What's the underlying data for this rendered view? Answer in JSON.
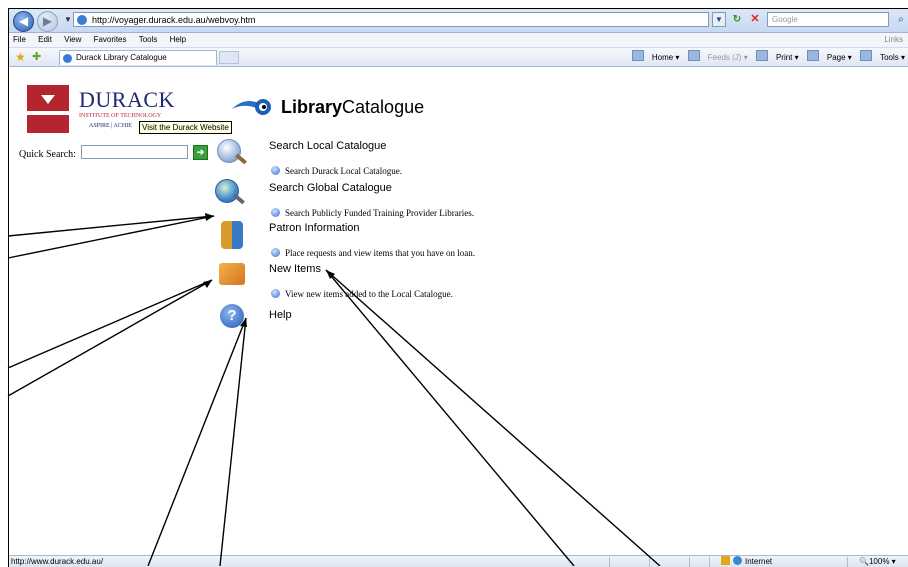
{
  "browser": {
    "url": "http://voyager.durack.edu.au/webvoy.htm",
    "search_placeholder": "Google",
    "menu": [
      "File",
      "Edit",
      "View",
      "Favorites",
      "Tools",
      "Help"
    ],
    "links_label": "Links",
    "tab_title": "Durack Library Catalogue",
    "commands": {
      "home": "Home",
      "feeds": "Feeds (J)",
      "print": "Print",
      "page": "Page",
      "tools": "Tools"
    }
  },
  "page": {
    "institution": {
      "name": "DURACK",
      "subtitle": "INSTITUTE OF TECHNOLOGY",
      "tagline": "ASPIRE | ACHIE"
    },
    "tooltip": "Visit the Durack Website",
    "catalogue_logo": {
      "bold": "Library",
      "normal": "Catalogue"
    },
    "quick_search_label": "Quick Search:",
    "sections": [
      {
        "title": "Search Local Catalogue",
        "link": "Search Durack Local Catalogue."
      },
      {
        "title": "Search Global Catalogue",
        "link": "Search Publicly Funded Training Provider Libraries."
      },
      {
        "title": "Patron Information",
        "link": "Place requests and view items that you have on loan."
      },
      {
        "title": "New Items",
        "link": "View new items added to the Local Catalogue."
      },
      {
        "title": "Help"
      }
    ]
  },
  "status": {
    "url": "http://www.durack.edu.au/",
    "zone": "Internet",
    "zoom": "100%"
  }
}
